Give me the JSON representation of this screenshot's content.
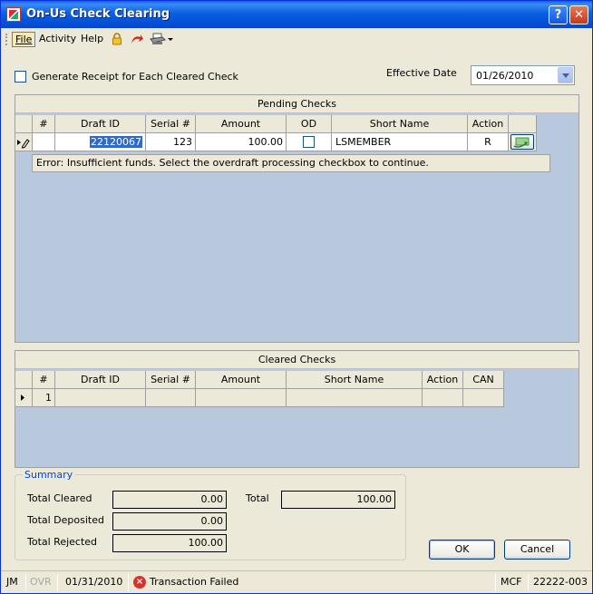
{
  "window": {
    "title": "On-Us Check Clearing"
  },
  "titlebar_buttons": {
    "help": "?",
    "close": "✕"
  },
  "menu": {
    "file": "File",
    "activity": "Activity",
    "help": "Help"
  },
  "options": {
    "generate_receipt_label": "Generate Receipt for Each Cleared Check",
    "generate_receipt_checked": false
  },
  "effective_date": {
    "label": "Effective Date",
    "value": "01/26/2010"
  },
  "pending": {
    "title": "Pending Checks",
    "columns": [
      "#",
      "Draft ID",
      "Serial #",
      "Amount",
      "OD",
      "Short Name",
      "Action"
    ],
    "rows": [
      {
        "num": "",
        "draft_id": "22120067",
        "serial": "123",
        "amount": "100.00",
        "od": false,
        "short_name": "LSMEMBER",
        "action": "R"
      }
    ],
    "error": "Error: Insufficient funds. Select the overdraft processing checkbox to continue."
  },
  "cleared": {
    "title": "Cleared Checks",
    "columns": [
      "#",
      "Draft ID",
      "Serial #",
      "Amount",
      "Short Name",
      "Action",
      "CAN"
    ],
    "rows": [
      {
        "num": "1",
        "draft_id": "",
        "serial": "",
        "amount": "",
        "short_name": "",
        "action": "",
        "can": ""
      }
    ]
  },
  "summary": {
    "title": "Summary",
    "total_cleared_label": "Total Cleared",
    "total_cleared": "0.00",
    "total_deposited_label": "Total Deposited",
    "total_deposited": "0.00",
    "total_rejected_label": "Total Rejected",
    "total_rejected": "100.00",
    "total_label": "Total",
    "total": "100.00"
  },
  "buttons": {
    "ok": "OK",
    "cancel": "Cancel"
  },
  "status": {
    "user": "JM",
    "ovr": "OVR",
    "date": "01/31/2010",
    "fail_icon": "×",
    "message": "Transaction Failed",
    "system": "MCF",
    "code": "22222-003"
  }
}
